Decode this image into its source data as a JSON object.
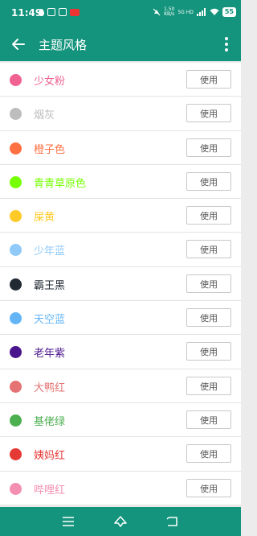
{
  "status": {
    "time": "11:49",
    "speed_value": "1.50",
    "speed_unit": "KB/s",
    "network": "5G HD",
    "battery": "55"
  },
  "header": {
    "title": "主题风格"
  },
  "action_label": "使用",
  "themes": [
    {
      "name": "少女粉",
      "color": "#f06292"
    },
    {
      "name": "烟灰",
      "color": "#bdbdbd"
    },
    {
      "name": "橙子色",
      "color": "#ff7043"
    },
    {
      "name": "青青草原色",
      "color": "#76ff03"
    },
    {
      "name": "屎黄",
      "color": "#ffca28"
    },
    {
      "name": "少年蓝",
      "color": "#90caf9"
    },
    {
      "name": "霸王黑",
      "color": "#212a33"
    },
    {
      "name": "天空蓝",
      "color": "#64b5f6"
    },
    {
      "name": "老年紫",
      "color": "#4a148c"
    },
    {
      "name": "大鸭红",
      "color": "#e57373"
    },
    {
      "name": "基佬绿",
      "color": "#4caf50"
    },
    {
      "name": "姨妈红",
      "color": "#e53935"
    },
    {
      "name": "哔哩红",
      "color": "#f48fb1"
    }
  ]
}
